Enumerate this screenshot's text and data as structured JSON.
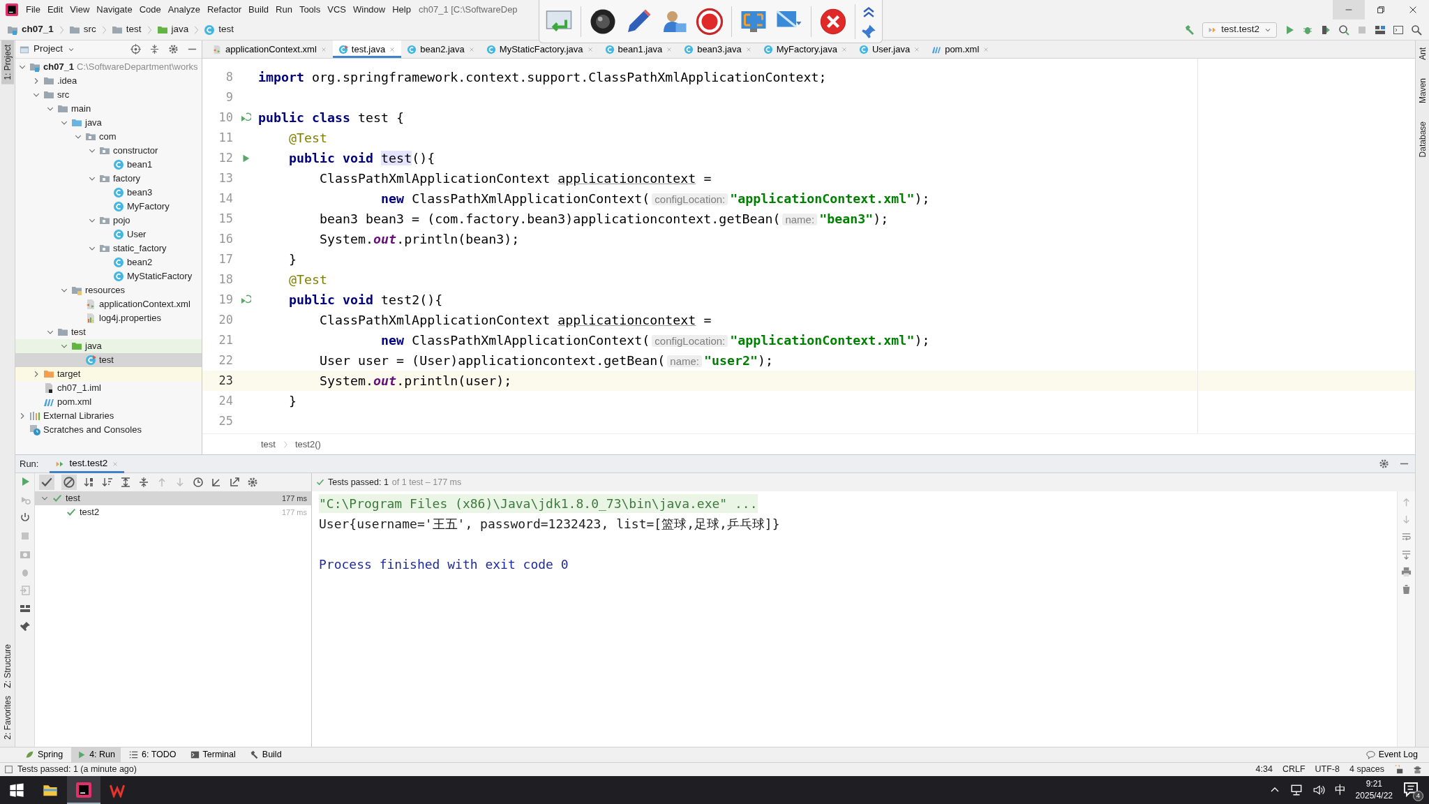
{
  "menu": [
    "File",
    "Edit",
    "View",
    "Navigate",
    "Code",
    "Analyze",
    "Refactor",
    "Build",
    "Run",
    "Tools",
    "VCS",
    "Window",
    "Help"
  ],
  "title": "ch07_1 [C:\\SoftwareDep",
  "nav_path": [
    {
      "label": "ch07_1",
      "kind": "module"
    },
    {
      "label": "src",
      "kind": "folder"
    },
    {
      "label": "test",
      "kind": "folder"
    },
    {
      "label": "java",
      "kind": "test-folder"
    },
    {
      "label": "test",
      "kind": "class"
    }
  ],
  "run_config": "test.test2",
  "project": {
    "title": "Project",
    "tree": [
      {
        "label": "ch07_1",
        "path": "C:\\SoftwareDepartment\\works",
        "kind": "module",
        "expanded": true,
        "selected": false,
        "children": [
          {
            "label": ".idea",
            "kind": "folder",
            "expanded": false,
            "selected": false
          },
          {
            "label": "src",
            "kind": "folder",
            "expanded": true,
            "selected": false,
            "children": [
              {
                "label": "main",
                "kind": "folder",
                "expanded": true,
                "selected": false,
                "children": [
                  {
                    "label": "java",
                    "kind": "src-folder",
                    "expanded": true,
                    "selected": false,
                    "children": [
                      {
                        "label": "com",
                        "kind": "package",
                        "expanded": true,
                        "selected": false,
                        "children": [
                          {
                            "label": "constructor",
                            "kind": "package",
                            "expanded": true,
                            "selected": false,
                            "children": [
                              {
                                "label": "bean1",
                                "kind": "class",
                                "selected": false
                              }
                            ]
                          },
                          {
                            "label": "factory",
                            "kind": "package",
                            "expanded": true,
                            "selected": false,
                            "children": [
                              {
                                "label": "bean3",
                                "kind": "class",
                                "selected": false
                              },
                              {
                                "label": "MyFactory",
                                "kind": "class",
                                "selected": false
                              }
                            ]
                          },
                          {
                            "label": "pojo",
                            "kind": "package",
                            "expanded": true,
                            "selected": false,
                            "children": [
                              {
                                "label": "User",
                                "kind": "class",
                                "selected": false
                              }
                            ]
                          },
                          {
                            "label": "static_factory",
                            "kind": "package",
                            "expanded": true,
                            "selected": false,
                            "children": [
                              {
                                "label": "bean2",
                                "kind": "class",
                                "selected": false
                              },
                              {
                                "label": "MyStaticFactory",
                                "kind": "class",
                                "selected": false
                              }
                            ]
                          }
                        ]
                      }
                    ]
                  },
                  {
                    "label": "resources",
                    "kind": "resources",
                    "expanded": true,
                    "selected": false,
                    "children": [
                      {
                        "label": "applicationContext.xml",
                        "kind": "xml",
                        "selected": false
                      },
                      {
                        "label": "log4j.properties",
                        "kind": "props",
                        "selected": false
                      }
                    ]
                  }
                ]
              },
              {
                "label": "test",
                "kind": "folder",
                "expanded": true,
                "selected": false,
                "children": [
                  {
                    "label": "java",
                    "kind": "test-folder",
                    "expanded": true,
                    "selected": false,
                    "children": [
                      {
                        "label": "test",
                        "kind": "test-class",
                        "selected": true
                      }
                    ]
                  }
                ]
              }
            ]
          },
          {
            "label": "target",
            "kind": "excluded",
            "expanded": false,
            "selected": false
          },
          {
            "label": "ch07_1.iml",
            "kind": "iml",
            "selected": false
          },
          {
            "label": "pom.xml",
            "kind": "maven",
            "selected": false
          }
        ]
      },
      {
        "label": "External Libraries",
        "kind": "libraries",
        "expanded": false,
        "selected": false
      },
      {
        "label": "Scratches and Consoles",
        "kind": "scratches",
        "selected": false
      }
    ]
  },
  "editor_tabs": [
    {
      "label": "applicationContext.xml",
      "kind": "xml",
      "selected": false
    },
    {
      "label": "test.java",
      "kind": "test-class",
      "selected": true
    },
    {
      "label": "bean2.java",
      "kind": "class",
      "selected": false
    },
    {
      "label": "MyStaticFactory.java",
      "kind": "class",
      "selected": false
    },
    {
      "label": "bean1.java",
      "kind": "class",
      "selected": false
    },
    {
      "label": "bean3.java",
      "kind": "class",
      "selected": false
    },
    {
      "label": "MyFactory.java",
      "kind": "class",
      "selected": false
    },
    {
      "label": "User.java",
      "kind": "class",
      "selected": false
    },
    {
      "label": "pom.xml",
      "kind": "maven",
      "selected": false
    }
  ],
  "code_lines": [
    {
      "number": "8",
      "kind": "code",
      "current": false,
      "tokens": [
        {
          "kind": "kw",
          "t": "import "
        },
        {
          "kind": "plain",
          "t": "org.springframework.context.support.ClassPathXmlApplicationContext;"
        }
      ]
    },
    {
      "number": "9",
      "kind": "code",
      "current": false
    },
    {
      "number": "10",
      "kind": "test-class",
      "current": false,
      "tokens": [
        {
          "kind": "kw",
          "t": "public class "
        },
        {
          "kind": "plain",
          "t": "test {"
        }
      ]
    },
    {
      "number": "11",
      "kind": "code",
      "current": false,
      "tokens": [
        {
          "kind": "ann",
          "t": "    @Test"
        }
      ]
    },
    {
      "number": "12",
      "kind": "test-method",
      "current": false,
      "tokens": [
        {
          "kind": "kw",
          "t": "    public void "
        },
        {
          "kind": "hl",
          "t": "test"
        },
        {
          "kind": "plain",
          "t": "(){"
        }
      ]
    },
    {
      "number": "13",
      "kind": "code",
      "current": false,
      "tokens": [
        {
          "kind": "plain",
          "t": "        ClassPathXmlApplicationContext "
        },
        {
          "kind": "ul",
          "t": "applicationcontext"
        },
        {
          "kind": "plain",
          "t": " ="
        }
      ]
    },
    {
      "number": "14",
      "kind": "code",
      "current": false,
      "tokens": [
        {
          "kind": "kw",
          "t": "                new "
        },
        {
          "kind": "plain",
          "t": "ClassPathXmlApplicationContext("
        },
        {
          "kind": "hint",
          "t": "configLocation:"
        },
        {
          "kind": "str",
          "t": "\"applicationContext.xml\""
        },
        {
          "kind": "plain",
          "t": ");"
        }
      ]
    },
    {
      "number": "15",
      "kind": "code",
      "current": false,
      "tokens": [
        {
          "kind": "plain",
          "t": "        bean3 bean3 = (com.factory.bean3)applicationcontext.getBean("
        },
        {
          "kind": "hint",
          "t": "name:"
        },
        {
          "kind": "str",
          "t": "\"bean3\""
        },
        {
          "kind": "plain",
          "t": ");"
        }
      ]
    },
    {
      "number": "16",
      "kind": "code",
      "current": false,
      "tokens": [
        {
          "kind": "plain",
          "t": "        System."
        },
        {
          "kind": "it",
          "t": "out"
        },
        {
          "kind": "plain",
          "t": ".println(bean3);"
        }
      ]
    },
    {
      "number": "17",
      "kind": "code",
      "current": false,
      "tokens": [
        {
          "kind": "plain",
          "t": "    }"
        }
      ]
    },
    {
      "number": "18",
      "kind": "code",
      "current": false,
      "tokens": [
        {
          "kind": "ann",
          "t": "    @Test"
        }
      ]
    },
    {
      "number": "19",
      "kind": "test-class",
      "current": false,
      "tokens": [
        {
          "kind": "kw",
          "t": "    public void "
        },
        {
          "kind": "plain",
          "t": "test2(){"
        }
      ]
    },
    {
      "number": "20",
      "kind": "code",
      "current": false,
      "tokens": [
        {
          "kind": "plain",
          "t": "        ClassPathXmlApplicationContext "
        },
        {
          "kind": "ul",
          "t": "applicationcontext"
        },
        {
          "kind": "plain",
          "t": " ="
        }
      ]
    },
    {
      "number": "21",
      "kind": "code",
      "current": false,
      "tokens": [
        {
          "kind": "kw",
          "t": "                new "
        },
        {
          "kind": "plain",
          "t": "ClassPathXmlApplicationContext("
        },
        {
          "kind": "hint",
          "t": "configLocation:"
        },
        {
          "kind": "str",
          "t": "\"applicationContext.xml\""
        },
        {
          "kind": "plain",
          "t": ");"
        }
      ]
    },
    {
      "number": "22",
      "kind": "code",
      "current": false,
      "tokens": [
        {
          "kind": "plain",
          "t": "        User user = (User)applicationcontext.getBean("
        },
        {
          "kind": "hint",
          "t": "name:"
        },
        {
          "kind": "str",
          "t": "\"user2\""
        },
        {
          "kind": "plain",
          "t": ");"
        }
      ]
    },
    {
      "number": "23",
      "kind": "code",
      "current": true,
      "tokens": [
        {
          "kind": "plain",
          "t": "        System."
        },
        {
          "kind": "it",
          "t": "out"
        },
        {
          "kind": "plain",
          "t": ".println(user);"
        }
      ]
    },
    {
      "number": "24",
      "kind": "code",
      "current": false,
      "tokens": [
        {
          "kind": "plain",
          "t": "    }"
        }
      ]
    },
    {
      "number": "25",
      "kind": "code",
      "current": false
    }
  ],
  "breadcrumb": [
    "test",
    "test2()"
  ],
  "run": {
    "label": "Run:",
    "tab": "test.test2",
    "status": "Tests passed: 1",
    "status_detail": "of 1 test – 177 ms",
    "tests": [
      {
        "name": "test",
        "time": "177 ms",
        "selected": true,
        "children": [
          {
            "name": "test2",
            "time": "177 ms",
            "selected": false
          }
        ]
      }
    ],
    "console": [
      {
        "kind": "cmd",
        "text": "\"C:\\Program Files (x86)\\Java\\jdk1.8.0_73\\bin\\java.exe\" ..."
      },
      {
        "kind": "out",
        "text": "User{username='王五', password=1232423, list=[篮球,足球,乒乓球]}"
      },
      {
        "kind": "blank"
      },
      {
        "kind": "exit",
        "text": "Process finished with exit code 0"
      }
    ]
  },
  "side_left": [
    {
      "label": "1: Project",
      "selected": true
    },
    {
      "label": "Z: Structure",
      "selected": false
    },
    {
      "label": "2: Favorites",
      "selected": false
    }
  ],
  "side_right": [
    "Ant",
    "Maven",
    "Database"
  ],
  "tool_tabs": [
    {
      "label": "Spring",
      "kind": "spring",
      "selected": false
    },
    {
      "label": "4: Run",
      "kind": "run",
      "selected": true
    },
    {
      "label": "6: TODO",
      "kind": "todo",
      "selected": false
    },
    {
      "label": "Terminal",
      "kind": "terminal",
      "selected": false
    },
    {
      "label": "Build",
      "kind": "build",
      "selected": false
    }
  ],
  "event_log": "Event Log",
  "status": {
    "message": "Tests passed: 1 (a minute ago)",
    "items": [
      "4:34",
      "CRLF",
      "UTF-8",
      "4 spaces"
    ]
  },
  "taskbar": {
    "ime": "中",
    "time": "9:21",
    "date": "2025/4/22",
    "notifications": "4"
  }
}
